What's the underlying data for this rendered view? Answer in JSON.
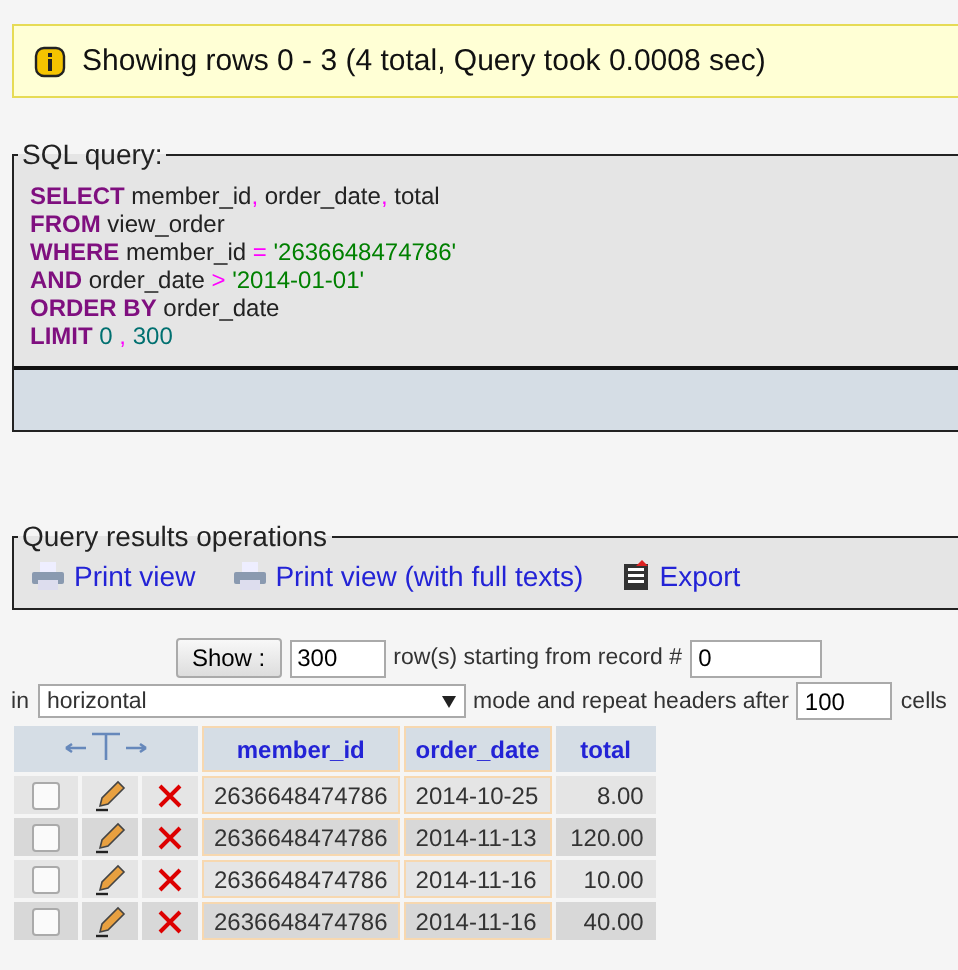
{
  "notice": {
    "text": "Showing rows 0 - 3 (4 total, Query took 0.0008 sec)"
  },
  "sql_query": {
    "legend": "SQL query:",
    "lines": [
      [
        {
          "kind": "keyword",
          "text": "SELECT"
        },
        {
          "kind": "ident",
          "text": " member_id"
        },
        {
          "kind": "punct",
          "text": ","
        },
        {
          "kind": "ident",
          "text": " order_date"
        },
        {
          "kind": "punct",
          "text": ","
        },
        {
          "kind": "ident",
          "text": " total"
        }
      ],
      [
        {
          "kind": "keyword",
          "text": "FROM"
        },
        {
          "kind": "ident",
          "text": " view_order"
        }
      ],
      [
        {
          "kind": "keyword",
          "text": "WHERE"
        },
        {
          "kind": "ident",
          "text": " member_id "
        },
        {
          "kind": "punct",
          "text": "="
        },
        {
          "kind": "string",
          "text": " '2636648474786'"
        }
      ],
      [
        {
          "kind": "keyword",
          "text": "AND"
        },
        {
          "kind": "ident",
          "text": " order_date "
        },
        {
          "kind": "punct",
          "text": ">"
        },
        {
          "kind": "string",
          "text": " '2014-01-01'"
        }
      ],
      [
        {
          "kind": "keyword",
          "text": "ORDER BY"
        },
        {
          "kind": "ident",
          "text": " order_date"
        }
      ],
      [
        {
          "kind": "keyword",
          "text": "LIMIT"
        },
        {
          "kind": "number",
          "text": " 0"
        },
        {
          "kind": "punct",
          "text": " ,"
        },
        {
          "kind": "number",
          "text": " 300"
        }
      ]
    ]
  },
  "operations": {
    "legend": "Query results operations",
    "links": [
      {
        "kind": "print",
        "label": "Print view"
      },
      {
        "kind": "print",
        "label": "Print view (with full texts)"
      },
      {
        "kind": "export",
        "label": "Export"
      }
    ]
  },
  "navigation": {
    "show_button": "Show :",
    "rows_value": "300",
    "rows_label": "row(s) starting from record #",
    "start_value": "0",
    "in_label": "in",
    "mode_value": "horizontal",
    "mode_label": "mode and repeat headers after",
    "repeat_value": "100",
    "cells_label": "cells"
  },
  "table": {
    "columns": [
      "member_id",
      "order_date",
      "total"
    ],
    "rows": [
      {
        "checked": false,
        "cells": [
          "2636648474786",
          "2014-10-25",
          "8.00"
        ]
      },
      {
        "checked": false,
        "cells": [
          "2636648474786",
          "2014-11-13",
          "120.00"
        ]
      },
      {
        "checked": false,
        "cells": [
          "2636648474786",
          "2014-11-16",
          "10.00"
        ]
      },
      {
        "checked": false,
        "cells": [
          "2636648474786",
          "2014-11-16",
          "40.00"
        ]
      }
    ]
  }
}
